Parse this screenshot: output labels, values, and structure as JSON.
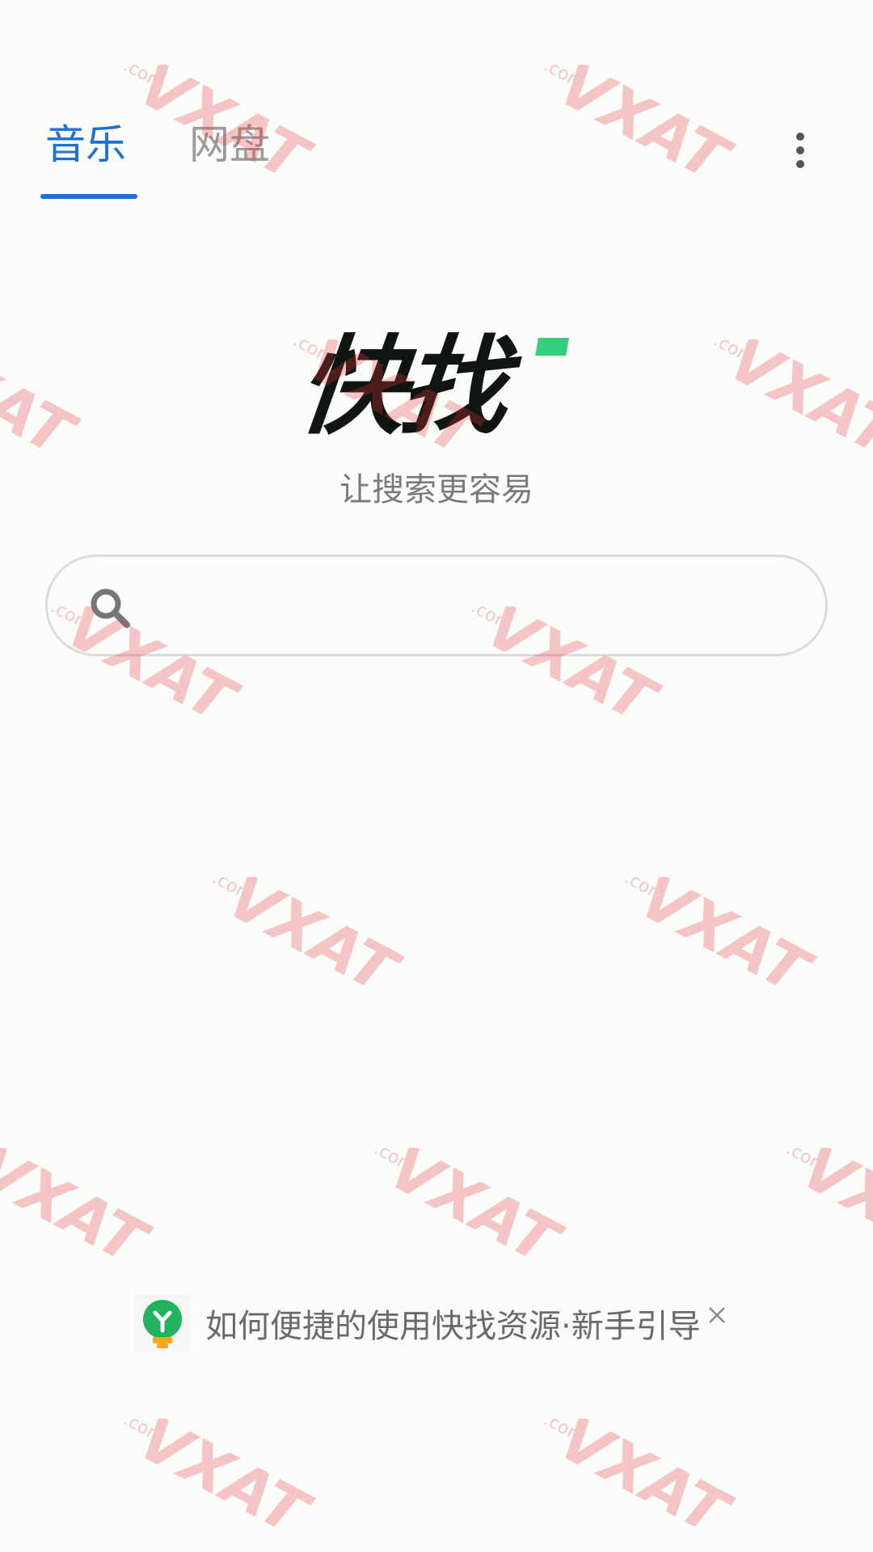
{
  "tabs": [
    {
      "label": "音乐",
      "active": true
    },
    {
      "label": "网盘",
      "active": false
    }
  ],
  "logo": {
    "text": "快找",
    "tagline": "让搜索更容易"
  },
  "search": {
    "placeholder": "",
    "value": ""
  },
  "guide": {
    "text": "如何便捷的使用快找资源·新手引导"
  },
  "watermark": {
    "text": "VXAT",
    "sub": ".com"
  },
  "colors": {
    "accent": "#1e6fd8",
    "logo_green": "#34cf7c",
    "guide_icon_green": "#22b35e",
    "guide_icon_orange": "#f5a623",
    "watermark": "#e8343a"
  }
}
